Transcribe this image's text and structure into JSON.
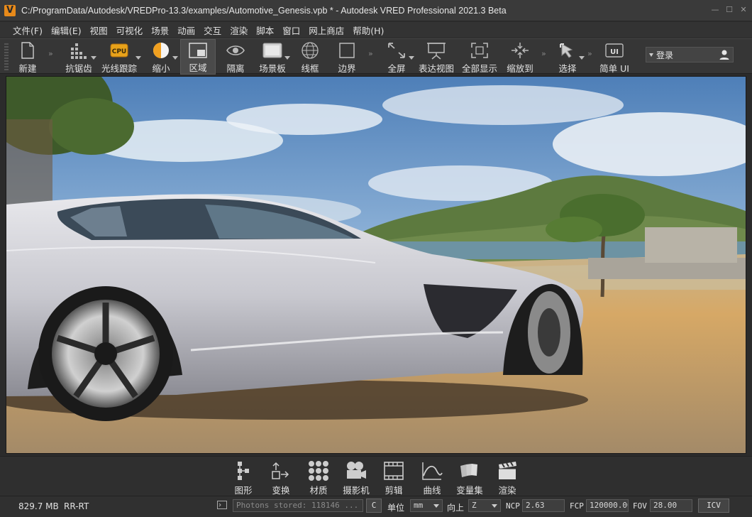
{
  "window": {
    "title": "C:/ProgramData/Autodesk/VREDPro-13.3/examples/Automotive_Genesis.vpb * - Autodesk VRED Professional 2021.3 Beta",
    "logo_letter": "V",
    "minimize": "—",
    "maximize": "☐",
    "close": "✕"
  },
  "menu": [
    "文件(F)",
    "编辑(E)",
    "视图",
    "可视化",
    "场景",
    "动画",
    "交互",
    "渲染",
    "脚本",
    "窗口",
    "网上商店",
    "帮助(H)"
  ],
  "toolbar": {
    "new": "新建",
    "antialias": "抗锯齿",
    "raytrace": "光线跟踪",
    "raytrace_badge": "CPU",
    "shrink": "缩小",
    "region": "区域",
    "isolate": "隔离",
    "sceneplate": "场景板",
    "wireframe": "线框",
    "border": "边界",
    "fullscreen": "全屏",
    "presentation": "表达视图",
    "show_all": "全部显示",
    "zoom_to": "缩放到",
    "select": "选择",
    "simple_ui": "简单 UI",
    "simple_ui_badge": "UI",
    "login": "登录"
  },
  "modules": [
    {
      "label": "图形",
      "icon": "graph-icon"
    },
    {
      "label": "变换",
      "icon": "transform-icon"
    },
    {
      "label": "材质",
      "icon": "materials-icon"
    },
    {
      "label": "摄影机",
      "icon": "camera-icon"
    },
    {
      "label": "剪辑",
      "icon": "clips-icon"
    },
    {
      "label": "曲线",
      "icon": "curves-icon"
    },
    {
      "label": "变量集",
      "icon": "variant-sets-icon"
    },
    {
      "label": "渲染",
      "icon": "render-icon"
    }
  ],
  "status": {
    "memory": "829.7 MB",
    "mode": "RR-RT",
    "photons": "Photons stored: 118146 ...",
    "c_button": "C",
    "unit_label": "单位",
    "unit_value": "mm",
    "up_label": "向上",
    "up_value": "Z",
    "ncp_label": "NCP",
    "ncp_value": "2.63",
    "fcp_label": "FCP",
    "fcp_value": "120000.00",
    "fov_label": "FOV",
    "fov_value": "28.00",
    "icv_button": "ICV"
  },
  "colors": {
    "accent": "#e88a1a",
    "bg": "#2b2b2b"
  }
}
